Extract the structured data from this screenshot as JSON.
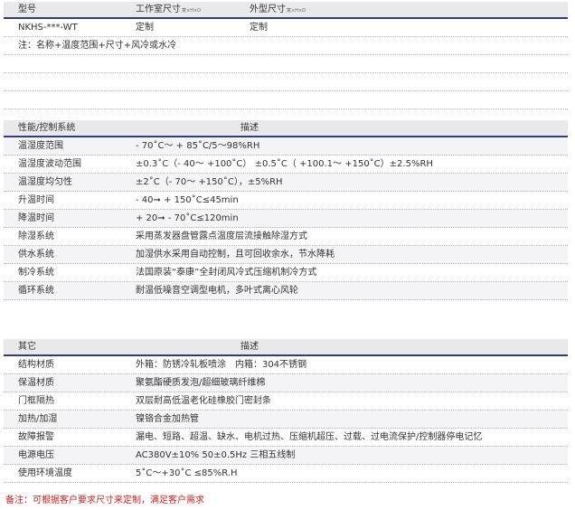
{
  "model_table": {
    "headers": {
      "model": "型号",
      "work_size": "工作室尺寸",
      "work_size_unit": "寛×H×D",
      "outer_size": "外型尺寸",
      "outer_size_unit": "寛×H×D"
    },
    "row": {
      "model": "NKHS-***-WT",
      "work_size": "定制",
      "outer_size": "定制"
    },
    "note": "注：名称+温度范围+尺寸+风冷或水冷"
  },
  "performance_table": {
    "headers": {
      "name": "性能/控制系统",
      "desc": "描述"
    },
    "rows": [
      {
        "name": "温湿度范围",
        "desc": "- 70˚C～ + 85˚C/5～98%RH"
      },
      {
        "name": "温湿度波动范围",
        "desc": "±0.3˚C（- 40～ +100˚C） ±0.5˚C（ +100.1～ +150˚C）±2.5%RH"
      },
      {
        "name": "温湿度均匀性",
        "desc": "±2˚C（- 70～ +150˚C），±5%RH"
      },
      {
        "name": "升温时间",
        "desc": "- 40➞ + 150˚C≤45min"
      },
      {
        "name": "降温时间",
        "desc": "+ 20➞ - 70˚C≤120min"
      },
      {
        "name": "除湿系统",
        "desc": "采用蒸发器盘管露点温度层流接触除湿方式"
      },
      {
        "name": "供水系统",
        "desc": "加湿供水采用自动控制，且可回收余水，节水降耗"
      },
      {
        "name": "制冷系统",
        "desc": "法国原装“泰康”全封闭风冷式压缩机制冷方式"
      },
      {
        "name": "循环系统",
        "desc": "耐温低噪音空调型电机，多叶式离心风轮"
      }
    ]
  },
  "other_table": {
    "headers": {
      "name": "其它",
      "desc": "描述"
    },
    "rows": [
      {
        "name": "结构材质",
        "desc": "外箱：防锈冷轧板喷涂　内箱：304不锈钢"
      },
      {
        "name": "保温材质",
        "desc": "聚氨酯硬质发泡/超细玻璃纤维棉"
      },
      {
        "name": "门框隔热",
        "desc": "双层耐高低温老化硅橡胶门密封条"
      },
      {
        "name": "加热/加湿",
        "desc": "镍铬合金加热管"
      },
      {
        "name": "故障报警",
        "desc": "漏电、短路、超温、缺水、电机过热、压缩机超压、过载、过电流保护/控制器停电记忆"
      },
      {
        "name": "电源电压",
        "desc": "AC380V±10% 50±0.5Hz 三相五线制"
      },
      {
        "name": "使用环境温度",
        "desc": "5˚C～+30˚C ≤85%R.H"
      }
    ]
  },
  "footer_note": "备注：可根据客户要求尺寸来定制，满足客户需求",
  "colors": {
    "header_bg": "#e9e9ec",
    "header_rule": "#2f3d78",
    "note_red": "#cc1f1f"
  }
}
